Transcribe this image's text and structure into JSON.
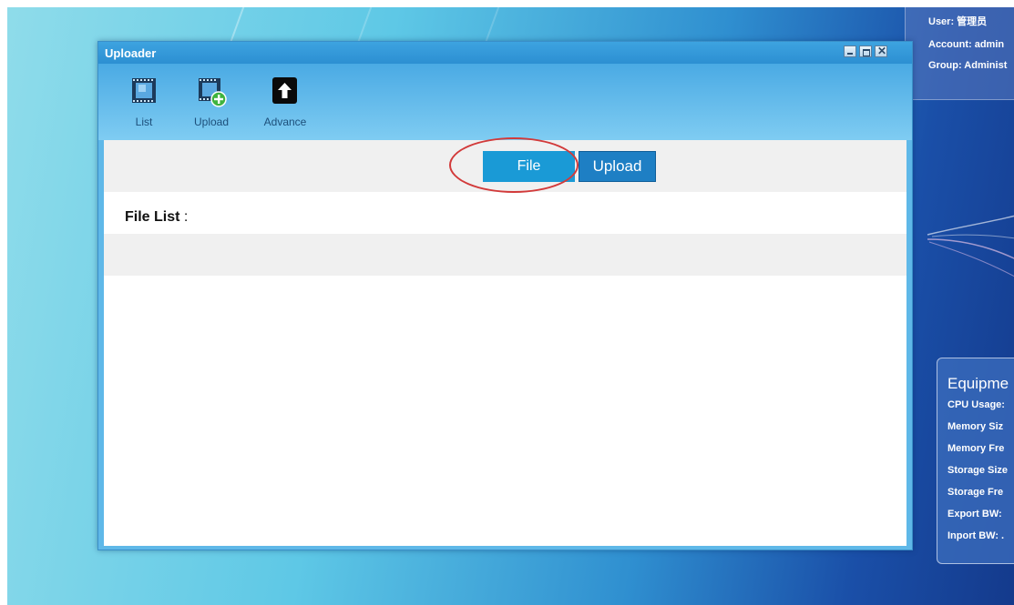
{
  "desktop": {
    "user_panel": {
      "user": "User: 管理员",
      "account": "Account: admin",
      "group": "Group: Administ"
    },
    "equipment_panel": {
      "title": "Equipme",
      "rows": [
        "CPU Usage:",
        "Memory Siz",
        "Memory Fre",
        "Storage Size",
        "Storage Fre",
        "Export BW:",
        "Inport BW: ."
      ]
    }
  },
  "window": {
    "title": "Uploader",
    "controls": [
      "minimize",
      "maximize",
      "close"
    ]
  },
  "toolbar": {
    "items": [
      {
        "label": "List",
        "icon": "film-icon"
      },
      {
        "label": "Upload",
        "icon": "film-add-icon"
      },
      {
        "label": "Advance",
        "icon": "arrow-up-icon"
      }
    ]
  },
  "action_bar": {
    "file_label": "File",
    "upload_label": "Upload"
  },
  "file_list": {
    "label": "File List",
    "colon": ":"
  },
  "colors": {
    "file_button": "#1a9ad6",
    "upload_button": "#1e7fc4",
    "highlight_circle": "#d23a3a",
    "window_frame": "#5fb8e8"
  }
}
